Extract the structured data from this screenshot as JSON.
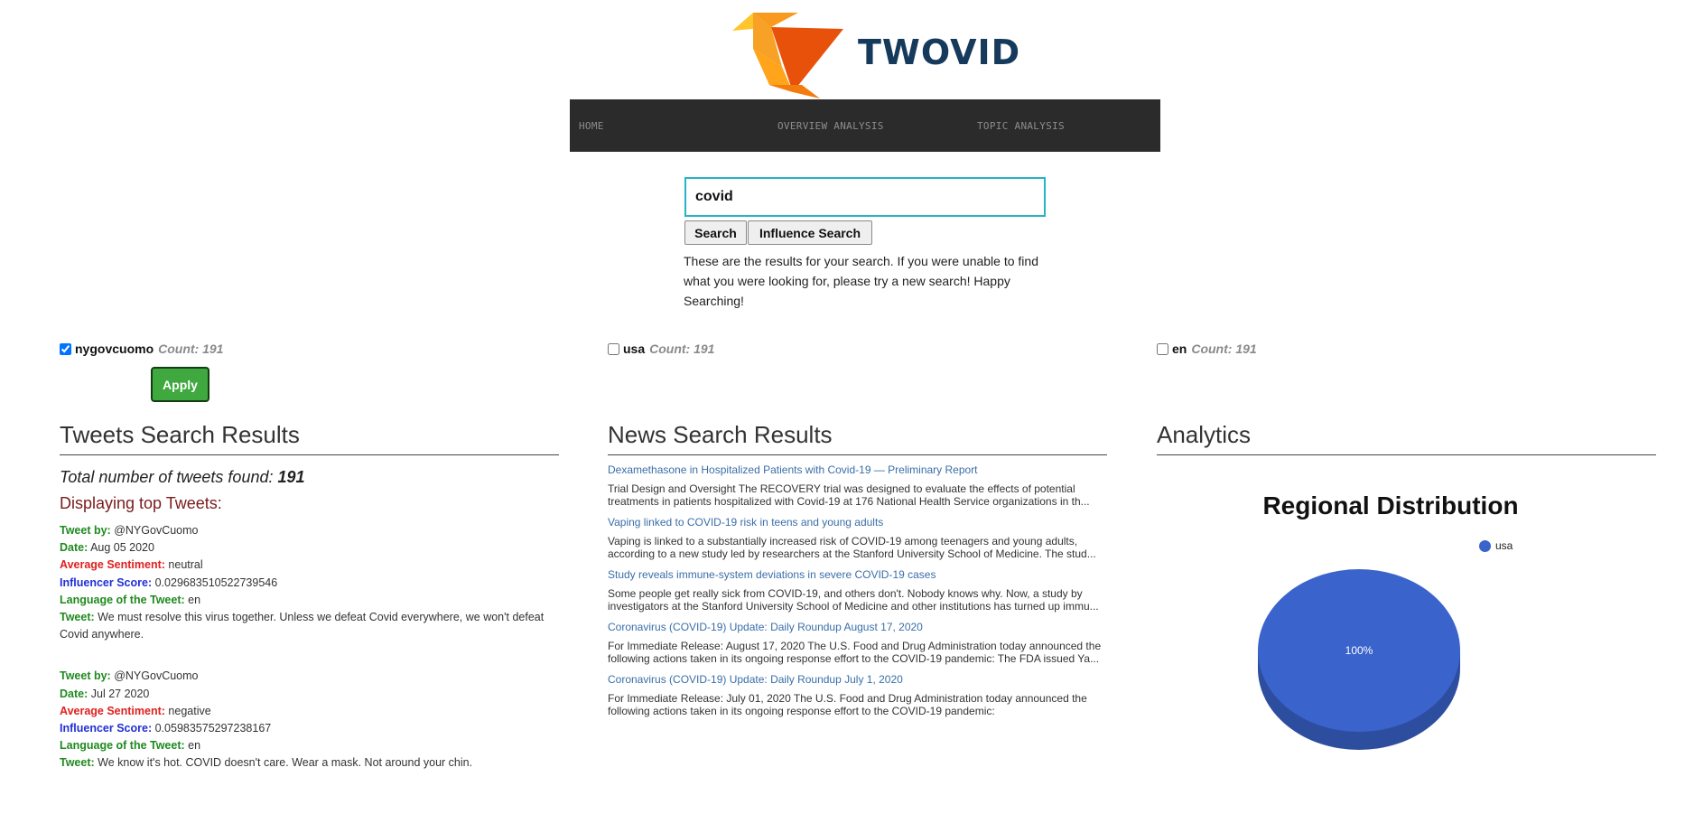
{
  "brand": {
    "name": "TWOVID"
  },
  "nav": {
    "items": [
      "HOME",
      "OVERVIEW ANALYSIS",
      "TOPIC ANALYSIS"
    ]
  },
  "search": {
    "value": "covid",
    "search_label": "Search",
    "influence_label": "Influence Search",
    "intro": "These are the results for your search. If you were unable to find what you were looking for, please try a new search! Happy Searching!"
  },
  "filters": [
    {
      "name": "nygovcuomo",
      "count": "Count: 191",
      "checked": true
    },
    {
      "name": "usa",
      "count": "Count: 191",
      "checked": false
    },
    {
      "name": "en",
      "count": "Count: 191",
      "checked": false
    }
  ],
  "apply_label": "Apply",
  "tweets": {
    "heading": "Tweets Search Results",
    "total_label": "Total number of tweets found:",
    "total_value": "191",
    "displaying": "Displaying top Tweets:",
    "labels": {
      "by": "Tweet by:",
      "date": "Date:",
      "sentiment": "Average Sentiment:",
      "influencer": "Influencer Score:",
      "language": "Language of the Tweet:",
      "tweet": "Tweet:"
    },
    "items": [
      {
        "by": "@NYGovCuomo",
        "date": "Aug 05 2020",
        "sentiment": "neutral",
        "influencer": "0.029683510522739546",
        "language": "en",
        "text": "We must resolve this virus together. Unless we defeat Covid everywhere, we won't defeat Covid anywhere."
      },
      {
        "by": "@NYGovCuomo",
        "date": "Jul 27 2020",
        "sentiment": "negative",
        "influencer": "0.05983575297238167",
        "language": "en",
        "text": "We know it's hot. COVID doesn't care. Wear a mask. Not around your chin."
      }
    ]
  },
  "news": {
    "heading": "News Search Results",
    "items": [
      {
        "title": "Dexamethasone in Hospitalized Patients with Covid-19 — Preliminary Report",
        "snippet": "Trial Design and Oversight The RECOVERY trial was designed to evaluate the effects of potential treatments in patients hospitalized with Covid-19 at 176 National Health Service organizations in th..."
      },
      {
        "title": "Vaping linked to COVID-19 risk in teens and young adults",
        "snippet": "Vaping is linked to a substantially increased risk of COVID-19 among teenagers and young adults, according to a new study led by researchers at the Stanford University School of Medicine. The stud..."
      },
      {
        "title": "Study reveals immune-system deviations in severe COVID-19 cases",
        "snippet": "Some people get really sick from COVID-19, and others don't. Nobody knows why. Now, a study by investigators at the Stanford University School of Medicine and other institutions has turned up immu..."
      },
      {
        "title": "Coronavirus (COVID-19) Update: Daily Roundup August 17, 2020",
        "snippet": "For Immediate Release: August 17, 2020 The U.S. Food and Drug Administration today announced the following actions taken in its ongoing response effort to the COVID-19 pandemic: The FDA issued Ya..."
      },
      {
        "title": "Coronavirus (COVID-19) Update: Daily Roundup July 1, 2020",
        "snippet": "For Immediate Release: July 01, 2020 The U.S. Food and Drug Administration today announced the following actions taken in its ongoing response effort to the COVID-19 pandemic:"
      }
    ]
  },
  "analytics": {
    "heading": "Analytics"
  },
  "chart_data": {
    "type": "pie",
    "title": "Regional Distribution",
    "categories": [
      "usa"
    ],
    "values": [
      100
    ],
    "data_labels": [
      "100%"
    ],
    "colors": [
      "#3a63cc"
    ],
    "legend_position": "top-right"
  }
}
